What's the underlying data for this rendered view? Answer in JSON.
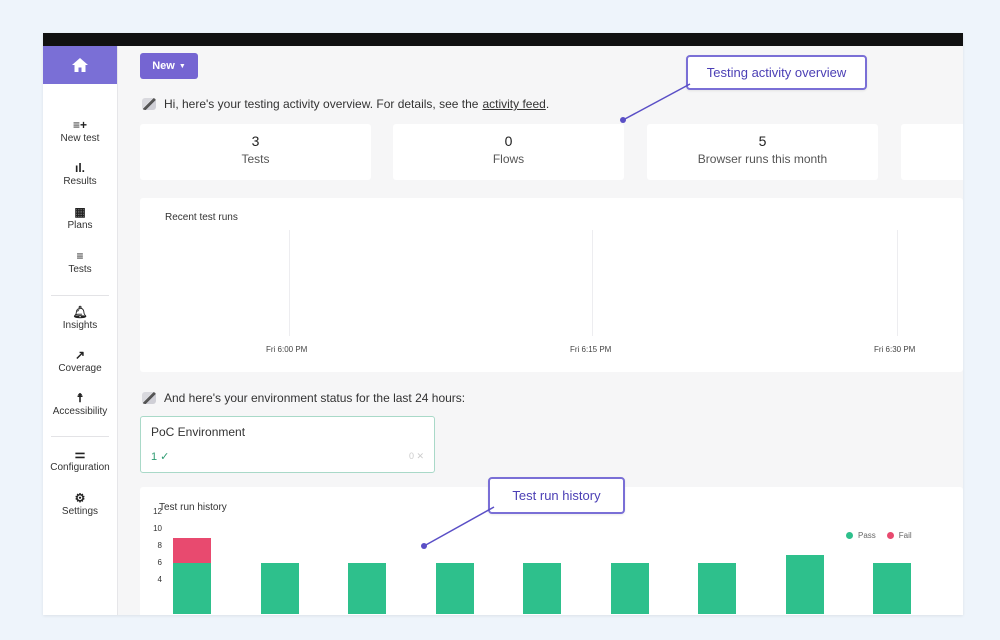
{
  "sidebar": {
    "items": [
      {
        "label": "New test",
        "icon": "playlist-add-icon"
      },
      {
        "label": "Results",
        "icon": "bar-chart-icon"
      },
      {
        "label": "Plans",
        "icon": "calendar-icon"
      },
      {
        "label": "Tests",
        "icon": "list-icon"
      },
      {
        "label": "Insights",
        "icon": "bell-icon"
      },
      {
        "label": "Coverage",
        "icon": "trend-icon"
      },
      {
        "label": "Accessibility",
        "icon": "accessibility-icon"
      },
      {
        "label": "Configuration",
        "icon": "sliders-icon"
      },
      {
        "label": "Settings",
        "icon": "gear-icon"
      }
    ]
  },
  "toolbar": {
    "new_label": "New"
  },
  "overview": {
    "greeting": "Hi, here's your testing activity overview. For details, see the",
    "link": "activity feed",
    "link_suffix": "."
  },
  "stats": [
    {
      "num": "3",
      "label": "Tests"
    },
    {
      "num": "0",
      "label": "Flows"
    },
    {
      "num": "5",
      "label": "Browser runs this month"
    }
  ],
  "recent": {
    "title": "Recent test runs",
    "ticks": [
      "Fri 6:00 PM",
      "Fri 6:15 PM",
      "Fri 6:30 PM"
    ]
  },
  "environment": {
    "intro": "And here's your environment status for the last 24 hours:",
    "card_name": "PoC Environment",
    "ok_count": "1 ✓",
    "fail_text": "0 ✕"
  },
  "history": {
    "title": "Test run history",
    "legend_pass": "Pass",
    "legend_fail": "Fail"
  },
  "colors": {
    "accent": "#7565d2",
    "pass": "#2ec08c",
    "fail": "#e84a6f"
  },
  "callouts": {
    "overview": "Testing activity overview",
    "history": "Test run history"
  },
  "chart_data": {
    "type": "bar",
    "title": "Test run history",
    "series": [
      {
        "name": "Pass",
        "values": [
          6,
          6,
          6,
          6,
          6,
          6,
          6,
          7,
          6
        ]
      },
      {
        "name": "Fail",
        "values": [
          3,
          0,
          0,
          0,
          0,
          0,
          0,
          0,
          0
        ]
      }
    ],
    "stacked": true,
    "y_ticks": [
      4,
      6,
      8,
      10,
      12
    ],
    "ylim": [
      0,
      12
    ],
    "legend": "top-right"
  }
}
